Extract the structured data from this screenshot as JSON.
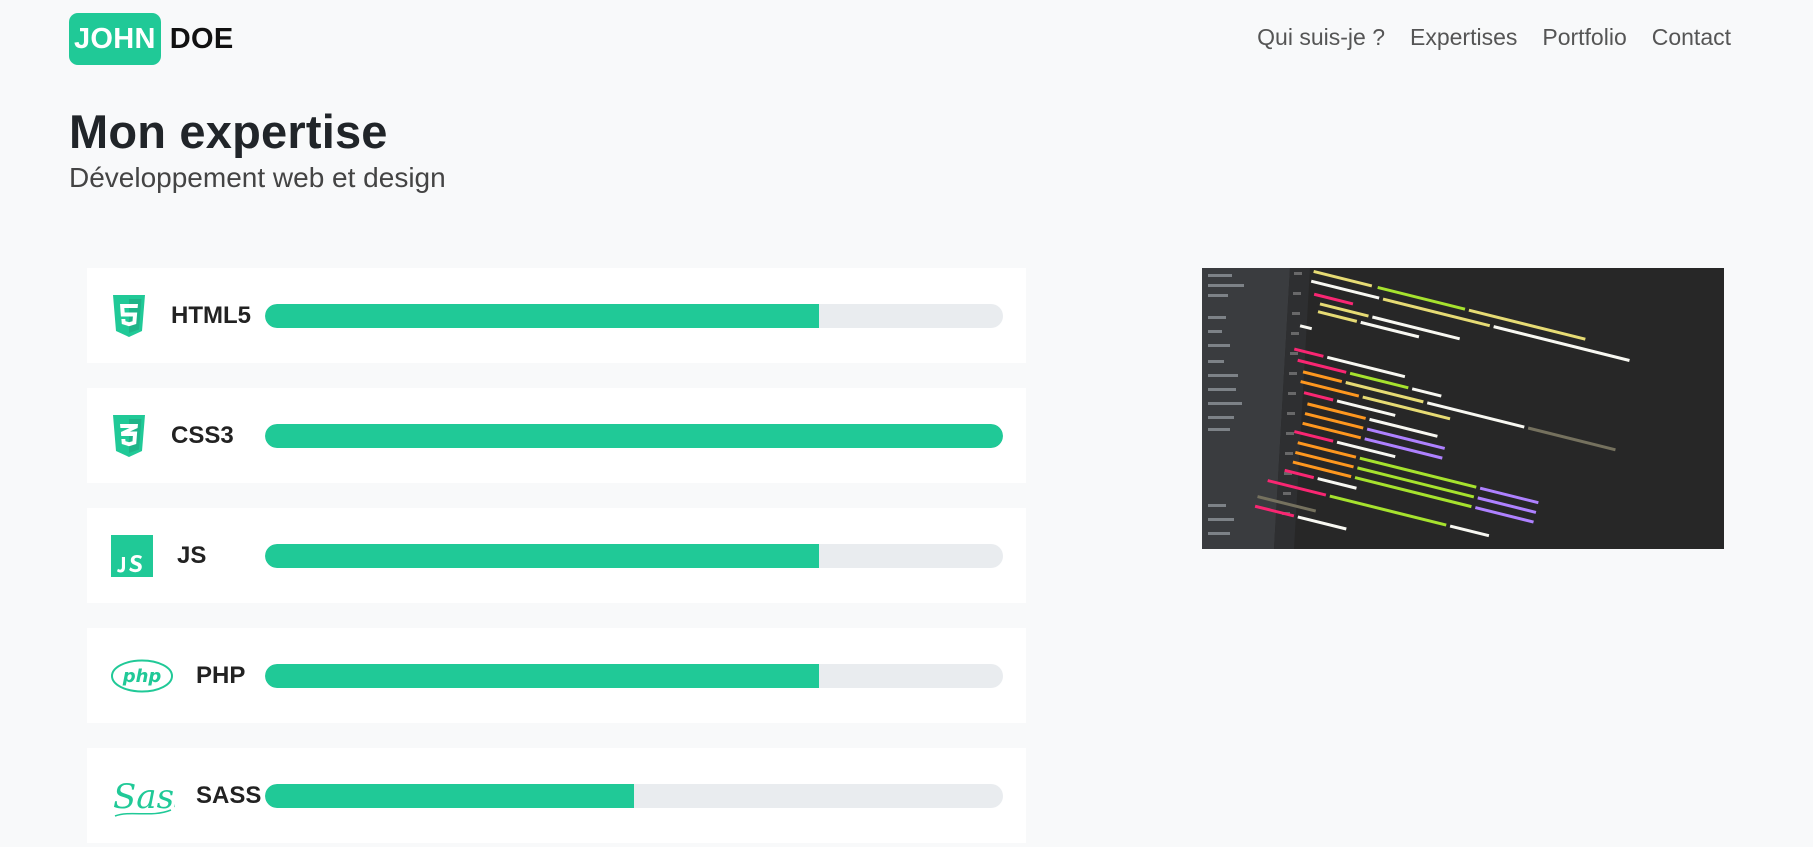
{
  "brand": {
    "highlight": "JOHN",
    "rest": "DOE",
    "accent": "#20c997"
  },
  "nav": {
    "items": [
      "Qui suis-je ?",
      "Expertises",
      "Portfolio",
      "Contact"
    ]
  },
  "heading": {
    "title": "Mon expertise",
    "subtitle": "Développement web et design"
  },
  "skills": [
    {
      "name": "HTML5",
      "icon": "html5-icon",
      "level": 0.75
    },
    {
      "name": "CSS3",
      "icon": "css3-icon",
      "level": 1.0
    },
    {
      "name": "JS",
      "icon": "js-icon",
      "level": 0.75
    },
    {
      "name": "PHP",
      "icon": "php-icon",
      "level": 0.75
    },
    {
      "name": "SASS",
      "icon": "sass-icon",
      "level": 0.5
    }
  ],
  "code_image": {
    "icon": "code-screenshot-image"
  },
  "colors": {
    "accent": "#20c997",
    "track": "#e9ecef",
    "background": "#f8f9fa"
  }
}
